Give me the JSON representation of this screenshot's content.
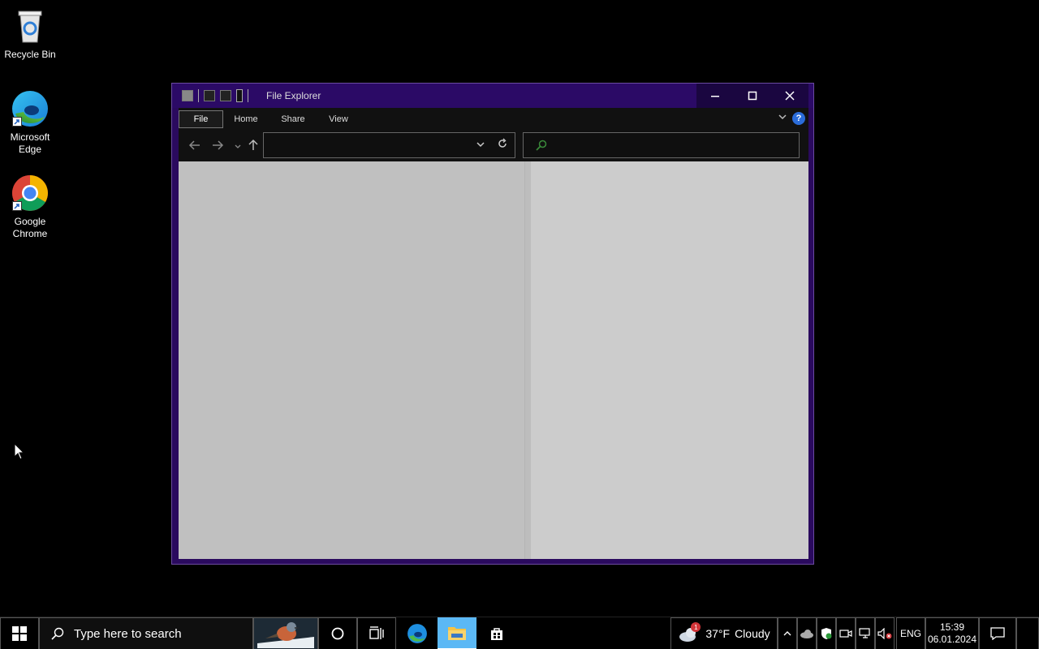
{
  "desktop": {
    "icons": [
      {
        "label": "Recycle Bin",
        "icon": "recycle-bin-icon"
      },
      {
        "label": "Microsoft Edge",
        "icon": "edge-icon"
      },
      {
        "label": "Google Chrome",
        "icon": "chrome-icon"
      }
    ]
  },
  "window": {
    "title": "File Explorer",
    "ribbon_tabs": [
      "File",
      "Home",
      "Share",
      "View"
    ],
    "address_value": "",
    "search_placeholder": "",
    "colors": {
      "frame": "#2b0a66",
      "pane_left": "#c0c0c0",
      "pane_right": "#cccccc"
    }
  },
  "taskbar": {
    "search_placeholder": "Type here to search",
    "weather": {
      "temp": "37°F",
      "condition": "Cloudy",
      "badge": "1"
    },
    "language": "ENG",
    "time": "15:39",
    "date": "06.01.2024"
  }
}
